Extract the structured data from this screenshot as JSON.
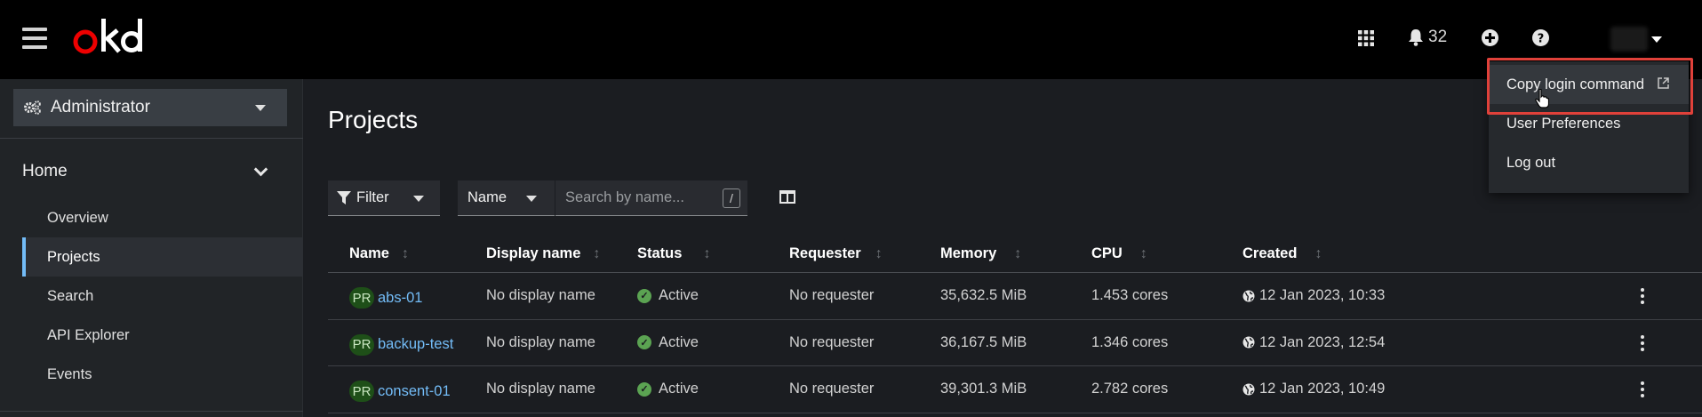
{
  "masthead": {
    "logo_text": "okd",
    "notifications_count": "32",
    "icons": [
      "menu-icon",
      "grid-icon",
      "bell-icon",
      "plus-circle-icon",
      "help-icon"
    ]
  },
  "sidebar": {
    "perspective": "Administrator",
    "section": "Home",
    "items": [
      {
        "label": "Overview",
        "active": false
      },
      {
        "label": "Projects",
        "active": true
      },
      {
        "label": "Search",
        "active": false
      },
      {
        "label": "API Explorer",
        "active": false
      },
      {
        "label": "Events",
        "active": false
      }
    ]
  },
  "main": {
    "title": "Projects",
    "filter_label": "Filter",
    "name_select": "Name",
    "search_placeholder": "Search by name...",
    "search_shortcut": "/"
  },
  "table": {
    "headers": [
      "Name",
      "Display name",
      "Status",
      "Requester",
      "Memory",
      "CPU",
      "Created"
    ],
    "badge": "PR",
    "rows": [
      {
        "name": "abs-01",
        "display_name": "No display name",
        "status": "Active",
        "requester": "No requester",
        "memory": "35,632.5 MiB",
        "cpu": "1.453 cores",
        "created": "12 Jan 2023, 10:33"
      },
      {
        "name": "backup-test",
        "display_name": "No display name",
        "status": "Active",
        "requester": "No requester",
        "memory": "36,167.5 MiB",
        "cpu": "1.346 cores",
        "created": "12 Jan 2023, 12:54"
      },
      {
        "name": "consent-01",
        "display_name": "No display name",
        "status": "Active",
        "requester": "No requester",
        "memory": "39,301.3 MiB",
        "cpu": "2.782 cores",
        "created": "12 Jan 2023, 10:49"
      }
    ]
  },
  "user_menu": {
    "items": [
      "Copy login command",
      "User Preferences",
      "Log out"
    ]
  },
  "colors": {
    "accent_link": "#73bcf7",
    "highlight_border": "#e0413a",
    "status_active": "#5ba352",
    "badge_bg": "#1e4f18"
  }
}
